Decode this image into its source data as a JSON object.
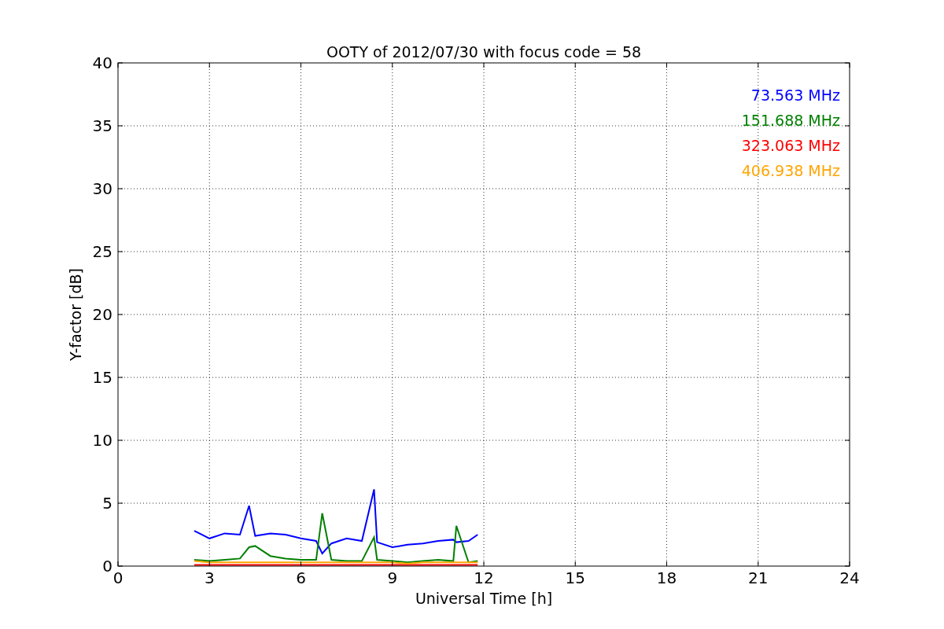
{
  "chart_data": {
    "type": "line",
    "title": "OOTY of 2012/07/30 with focus code = 58",
    "xlabel": "Universal Time [h]",
    "ylabel": "Y-factor [dB]",
    "x": [
      2.5,
      3,
      3.5,
      4,
      4.3,
      4.5,
      5,
      5.5,
      6,
      6.5,
      6.7,
      7,
      7.5,
      8,
      8.4,
      8.5,
      9,
      9.5,
      10,
      10.5,
      11,
      11.1,
      11.5,
      11.8
    ],
    "series": [
      {
        "name": "73.563 MHz",
        "color": "#0000ff",
        "values": [
          2.8,
          2.2,
          2.6,
          2.5,
          4.8,
          2.4,
          2.6,
          2.5,
          2.2,
          2.0,
          1.0,
          1.8,
          2.2,
          2.0,
          6.1,
          1.9,
          1.5,
          1.7,
          1.8,
          2.0,
          2.1,
          1.9,
          2.0,
          2.5
        ]
      },
      {
        "name": "151.688 MHz",
        "color": "#008000",
        "values": [
          0.5,
          0.4,
          0.5,
          0.6,
          1.5,
          1.6,
          0.8,
          0.6,
          0.5,
          0.5,
          4.2,
          0.5,
          0.4,
          0.4,
          2.3,
          0.5,
          0.4,
          0.3,
          0.4,
          0.5,
          0.4,
          3.2,
          0.3,
          0.4
        ]
      },
      {
        "name": "323.063 MHz",
        "color": "#ff0000",
        "values": [
          0.1,
          0.1,
          0.1,
          0.1,
          0.1,
          0.1,
          0.1,
          0.1,
          0.1,
          0.1,
          0.1,
          0.1,
          0.1,
          0.1,
          0.1,
          0.1,
          0.1,
          0.1,
          0.1,
          0.1,
          0.1,
          0.1,
          0.1,
          0.1
        ]
      },
      {
        "name": "406.938 MHz",
        "color": "#ffa500",
        "values": [
          0.4,
          0.3,
          0.3,
          0.3,
          0.3,
          0.3,
          0.3,
          0.3,
          0.3,
          0.3,
          0.3,
          0.3,
          0.3,
          0.3,
          0.3,
          0.3,
          0.3,
          0.2,
          0.3,
          0.3,
          0.3,
          0.3,
          0.3,
          0.3
        ]
      }
    ],
    "grid": true,
    "xlim": [
      0,
      24
    ],
    "ylim": [
      0,
      40
    ],
    "xticks": [
      0,
      3,
      6,
      9,
      12,
      15,
      18,
      21,
      24
    ],
    "yticks": [
      0,
      5,
      10,
      15,
      20,
      25,
      30,
      35,
      40
    ]
  }
}
